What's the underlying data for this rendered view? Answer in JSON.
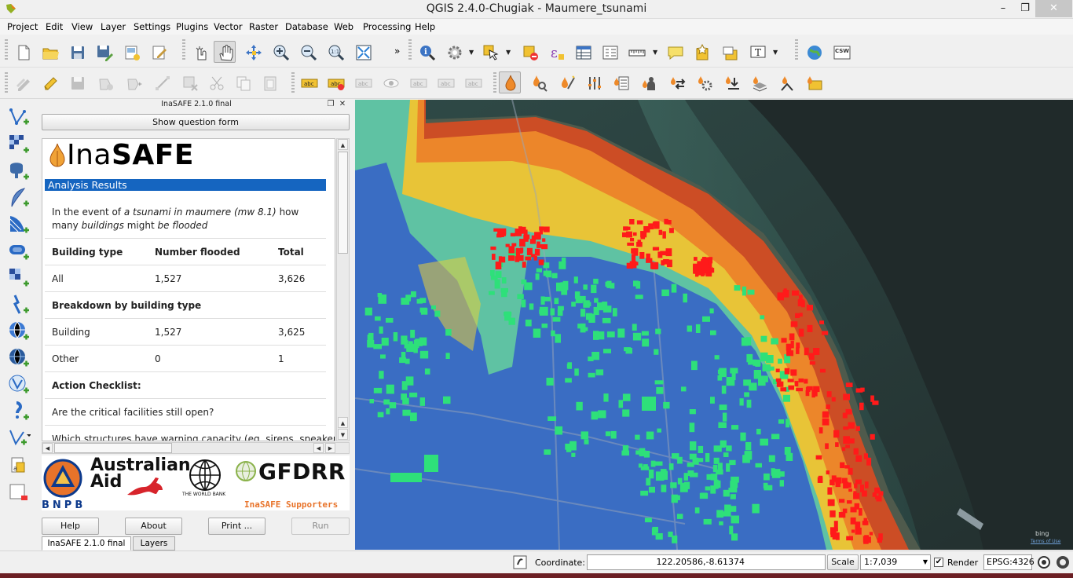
{
  "window": {
    "title": "QGIS 2.4.0-Chugiak - Maumere_tsunami",
    "minimize": "–",
    "restore": "❐",
    "close": "✕"
  },
  "menu": [
    "Project",
    "Edit",
    "View",
    "Layer",
    "Settings",
    "Plugins",
    "Vector",
    "Raster",
    "Database",
    "Web",
    "Processing",
    "Help"
  ],
  "toolbar1": {
    "icons": [
      "new-project-icon",
      "open-project-icon",
      "save-project-icon",
      "save-as-icon",
      "new-print-composer-icon",
      "composer-manager-icon",
      "touch-zoom-icon",
      "pan-map-icon",
      "pan-to-selection-icon",
      "zoom-in-icon",
      "zoom-out-icon",
      "zoom-actual-icon",
      "zoom-full-icon",
      "identify-icon",
      "run-action-icon",
      "select-features-icon",
      "deselect-icon",
      "field-calculator-icon",
      "attribute-table-icon",
      "statistics-icon",
      "measure-icon",
      "map-tips-icon",
      "new-bookmark-icon",
      "show-bookmarks-icon",
      "text-annotation-icon",
      "openlayers-icon",
      "csw-icon"
    ],
    "overflow": "»",
    "csw_label": "CSW"
  },
  "toolbar2": {
    "icons": [
      "current-edits-icon",
      "toggle-editing-icon",
      "save-edits-icon",
      "add-feature-icon",
      "move-feature-icon",
      "node-tool-icon",
      "delete-selected-icon",
      "cut-features-icon",
      "copy-features-icon",
      "paste-features-icon",
      "label-tool-icon",
      "label-highlight-icon",
      "label-pin-icon",
      "label-show-hide-icon",
      "label-move-icon",
      "label-rotate-icon",
      "label-change-icon",
      "inasafe-dock-icon",
      "inasafe-keywords-icon",
      "inasafe-wizard-icon",
      "inasafe-options-icon",
      "inasafe-impact-icon",
      "inasafe-minimum-needs-icon",
      "inasafe-shakemap-icon",
      "inasafe-batch-icon",
      "inasafe-save-scenario-icon",
      "inasafe-osm-download-icon",
      "inasafe-import-dialog-icon",
      "inasafe-analysis-extent-icon"
    ]
  },
  "left_toolbar": {
    "icons": [
      "add-vector-layer-icon",
      "add-raster-layer-icon",
      "add-postgis-layer-icon",
      "add-spatialite-layer-icon",
      "add-mssql-layer-icon",
      "add-oracle-layer-icon",
      "add-wms-layer-icon",
      "add-wcs-layer-icon",
      "add-wfs-layer-icon",
      "add-delimited-text-icon",
      "new-shapefile-icon",
      "new-spatialite-icon",
      "new-temporary-layer-icon"
    ]
  },
  "dock": {
    "title": "InaSAFE 2.1.0 final",
    "show_question_form": "Show question form",
    "logo_light": "Ina",
    "logo_bold": "SAFE",
    "analysis_results": "Analysis Results",
    "question": {
      "p1": "In the event of ",
      "hazard": "a tsunami in maumere (mw 8.1)",
      "p2": " how many ",
      "exposure": "buildings",
      "p3": " might ",
      "impact": "be flooded"
    },
    "table": {
      "headers": [
        "Building type",
        "Number flooded",
        "Total"
      ],
      "rows": [
        {
          "type": "All",
          "flooded": "1,527",
          "total": "3,626"
        }
      ],
      "breakdown_title": "Breakdown by building type",
      "breakdown_rows": [
        {
          "type": "Building",
          "flooded": "1,527",
          "total": "3,625"
        },
        {
          "type": "Other",
          "flooded": "0",
          "total": "1"
        }
      ],
      "checklist_title": "Action Checklist:",
      "checklist": [
        "Are the critical facilities still open?",
        "Which structures have warning capacity (eg. sirens, speakers,"
      ]
    },
    "supporters": {
      "bnpb": "BNPB",
      "australian_aid": "Australian",
      "aid": "Aid",
      "world_bank": "THE WORLD BANK",
      "gfdrr": "GFDRR",
      "label": "InaSAFE Supporters"
    },
    "buttons": {
      "help": "Help",
      "about": "About",
      "print": "Print ...",
      "run": "Run"
    },
    "tabs": [
      "InaSAFE 2.1.0 final",
      "Layers"
    ]
  },
  "map": {
    "attribution": "bing",
    "terms": "Terms of Use",
    "colors": {
      "sea": "#3b5350",
      "land": "#4f5a4c",
      "blue_overlay": "#2b4bd8",
      "cyan": "#29c3d4",
      "yellow": "#e8d23a",
      "orange": "#ee8a2a",
      "red": "#d92b2b",
      "building_safe": "#2ee07a",
      "building_flooded": "#ff1a1a"
    }
  },
  "statusbar": {
    "coordinate_label": "Coordinate:",
    "coordinate_value": "122.20586,-8.61374",
    "scale_label": "Scale",
    "scale_value": "1:7,039",
    "render_label": "Render",
    "render_checked": true,
    "epsg": "EPSG:4326"
  }
}
